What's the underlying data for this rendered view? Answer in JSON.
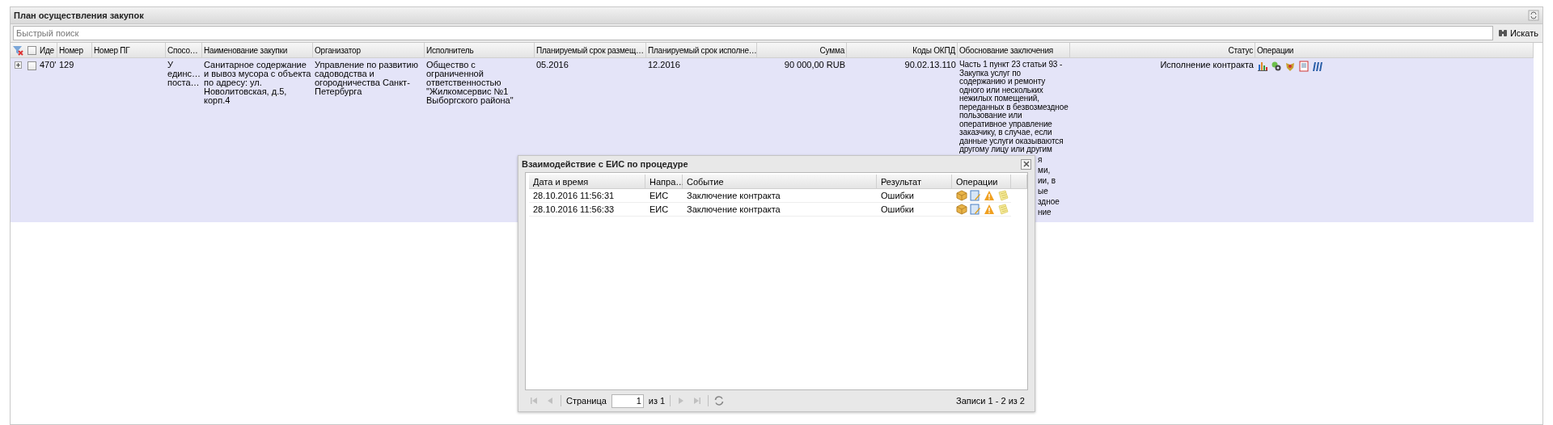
{
  "panel": {
    "title": "План осуществления закупок"
  },
  "search": {
    "placeholder": "Быстрый поиск",
    "button": "Искать"
  },
  "table": {
    "select_all_checked": false,
    "columns": [
      "Иде",
      "Номер",
      "Номер ПГ",
      "Спосо…",
      "Наименование закупки",
      "Организатор",
      "Исполнитель",
      "Планируемый срок размещ…",
      "Планируемый срок исполне…",
      "Сумма",
      "Коды ОКПД",
      "Обоснование заключения",
      "Статус",
      "Операции"
    ],
    "rows": [
      {
        "selected": true,
        "checked": false,
        "expanded": false,
        "id": "470'",
        "number": "129",
        "method": "У единс… поста…",
        "name": "Санитарное содержание и вывоз мусора с объекта по адресу: ул. Новолитовская, д.5, корп.4",
        "organizer": "Управление по развитию садоводства и огородничества Санкт-Петербурга",
        "executor": "Общество с ограниченной ответственностью \"Жилкомсервис №1 Выборгского района\"",
        "placement_term": "05.2016",
        "execution_term": "12.2016",
        "sum": "90 000,00 RUB",
        "okpd": "90.02.13.110",
        "justification": [
          "Часть 1 пункт 23 статьи 93 -",
          "Закупка услуг по",
          "содержанию и ремонту",
          "одного или нескольких",
          "нежилых помещений,",
          "переданных в безвозмездное",
          "пользование или",
          "оперативное управление",
          "заказчику, в случае, если",
          "данные услуги оказываются",
          "другому лицу или другим"
        ],
        "justification_tail": [
          "я",
          "ми,",
          "ии, в",
          "ые",
          "здное",
          "ние"
        ],
        "status": "Исполнение контракта"
      }
    ]
  },
  "dialog": {
    "title": "Взаимодействие с ЕИС по процедуре",
    "columns": [
      "Дата и время",
      "Напра…",
      "Событие",
      "Результат",
      "Операции"
    ],
    "rows": [
      {
        "selected": false,
        "datetime": "28.10.2016 11:56:31",
        "direction": "ЕИС",
        "event": "Заключение контракта",
        "result": "Ошибки"
      },
      {
        "selected": false,
        "datetime": "28.10.2016 11:56:33",
        "direction": "ЕИС",
        "event": "Заключение контракта",
        "result": "Ошибки"
      }
    ],
    "pager": {
      "page_label": "Страница",
      "page": "1",
      "of": "из 1",
      "summary": "Записи 1 - 2 из 2",
      "buttons": [
        {
          "kind": "first",
          "disabled": true
        },
        {
          "kind": "prev",
          "disabled": true
        },
        {
          "kind": "next",
          "disabled": true
        },
        {
          "kind": "last",
          "disabled": true
        }
      ]
    }
  }
}
